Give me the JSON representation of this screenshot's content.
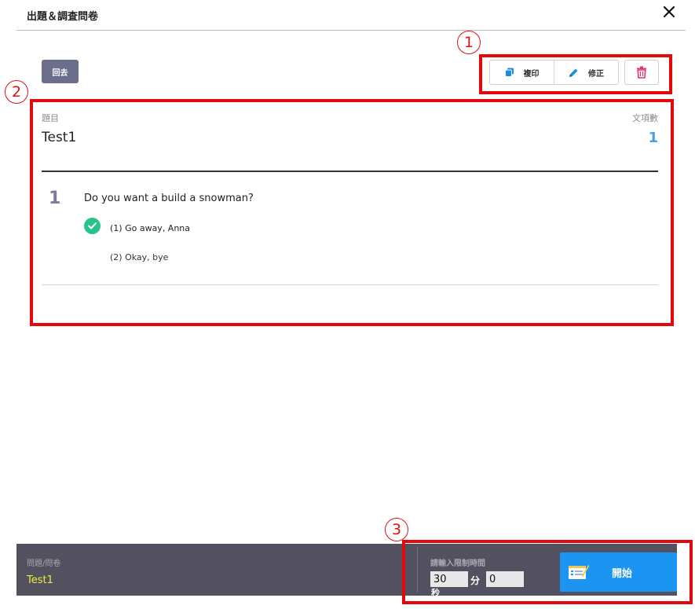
{
  "header": {
    "title": "出題＆調査問卷"
  },
  "toolbar": {
    "back_label": "回去",
    "copy_label": "複印",
    "edit_label": "修正"
  },
  "question": {
    "subject_label": "題目",
    "subject_value": "Test1",
    "count_label": "文項數",
    "count_value": "1",
    "number": "1",
    "text": "Do you want a build a snowman?",
    "options": [
      "(1) Go away, Anna",
      "(2) Okay, bye"
    ],
    "correct_option_index": 0
  },
  "footer": {
    "item_label": "問題/問卷",
    "item_value": "Test1",
    "time_label": "請輸入限制時間",
    "minutes_value": "30",
    "minutes_unit": "分",
    "seconds_value": "0",
    "seconds_unit": "秒",
    "start_label": "開始"
  },
  "annotations": [
    "1",
    "2",
    "3"
  ],
  "colors": {
    "annotation_red": "#e4080a",
    "count_blue": "#4a9fe8",
    "check_green": "#29c28b",
    "footer_bg": "#53515f",
    "footer_value_yellow": "#e7ef3a",
    "start_blue": "#1b95f1",
    "back_btn": "#6c6f8c"
  },
  "icons": [
    "close-icon",
    "copy-icon",
    "pencil-icon",
    "trash-icon",
    "check-icon",
    "form-icon"
  ]
}
